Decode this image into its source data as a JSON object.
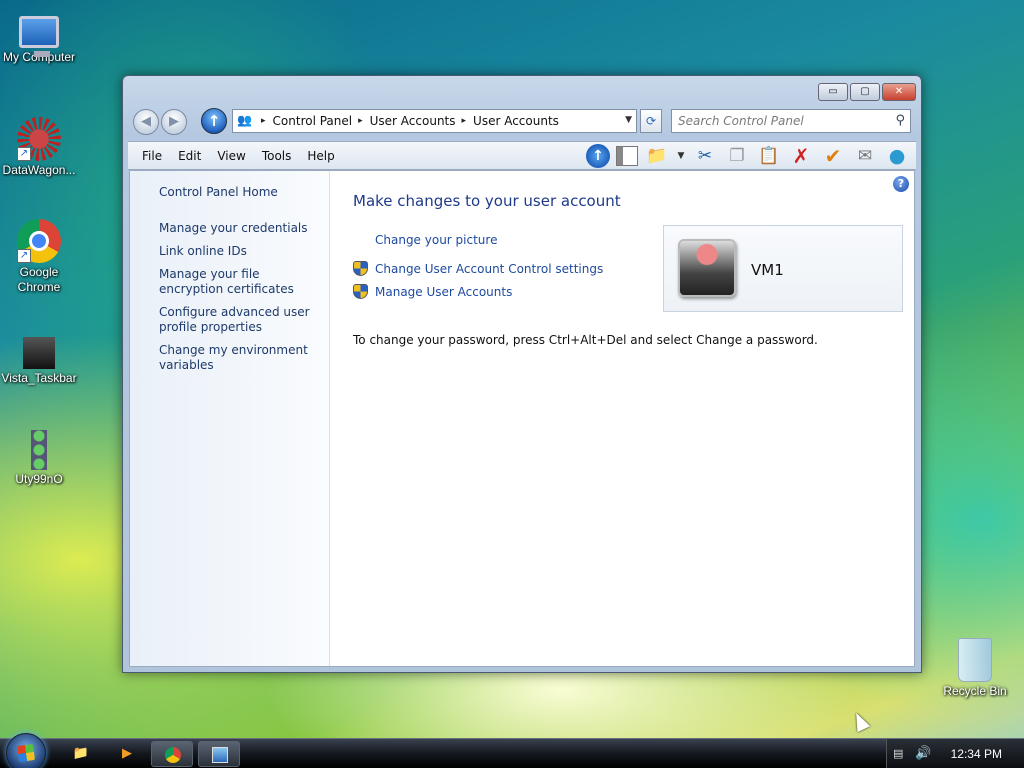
{
  "desktop": {
    "icons": [
      {
        "label": "My Computer",
        "icon": "computer-icon"
      },
      {
        "label": "DataWagon...",
        "icon": "datawagon-icon"
      },
      {
        "label": "Google Chrome",
        "icon": "chrome-icon"
      },
      {
        "label": "Vista_Taskbar",
        "icon": "vista-taskbar-icon"
      },
      {
        "label": "Uty99nO",
        "icon": "uty-icon"
      },
      {
        "label": "Recycle Bin",
        "icon": "recycle-bin-icon"
      }
    ]
  },
  "window": {
    "controls": {
      "minimize": "▭",
      "maximize": "▢",
      "close": "✕"
    },
    "nav": {
      "back": "◀",
      "forward": "▶",
      "up": "↑"
    },
    "breadcrumb": [
      "Control Panel",
      "User Accounts",
      "User Accounts"
    ],
    "breadcrumb_sep": "▸",
    "search_placeholder": "Search Control Panel",
    "menu": [
      "File",
      "Edit",
      "View",
      "Tools",
      "Help"
    ],
    "sidebar": {
      "home": "Control Panel Home",
      "links": [
        "Manage your credentials",
        "Link online IDs",
        "Manage your file encryption certificates",
        "Configure advanced user profile properties",
        "Change my environment variables"
      ]
    },
    "main": {
      "title": "Make changes to your user account",
      "tasks": [
        {
          "label": "Change your picture",
          "shield": false
        },
        {
          "label": "Change User Account Control settings",
          "shield": true
        },
        {
          "label": "Manage User Accounts",
          "shield": true
        }
      ],
      "user_name": "VM1",
      "password_note": "To change your password, press Ctrl+Alt+Del and select Change a password."
    }
  },
  "taskbar": {
    "clock": "12:34 PM"
  },
  "colors": {
    "link": "#1e4aa0",
    "title": "#1e3a8a",
    "sidebar_link": "#1e3a6a"
  }
}
